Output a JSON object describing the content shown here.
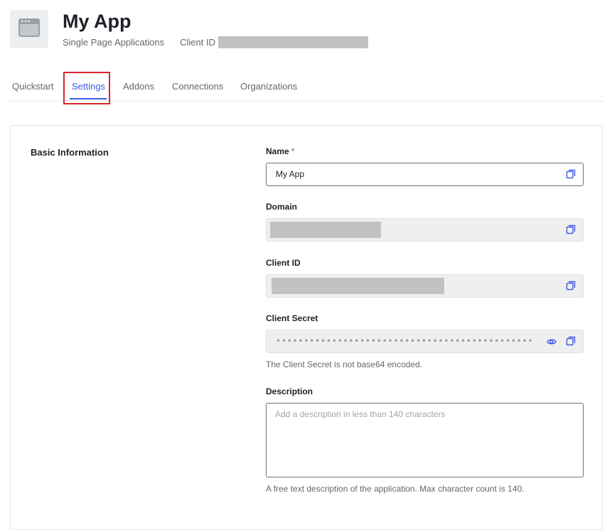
{
  "app": {
    "title": "My App",
    "type": "Single Page Applications",
    "client_id_label": "Client ID"
  },
  "tabs": [
    {
      "label": "Quickstart"
    },
    {
      "label": "Settings",
      "active": true
    },
    {
      "label": "Addons"
    },
    {
      "label": "Connections"
    },
    {
      "label": "Organizations"
    }
  ],
  "section": {
    "title": "Basic Information"
  },
  "fields": {
    "name": {
      "label": "Name",
      "required_mark": "*",
      "value": "My App"
    },
    "domain": {
      "label": "Domain"
    },
    "client_id": {
      "label": "Client ID"
    },
    "client_secret": {
      "label": "Client Secret",
      "mask": "••••••••••••••••••••••••••••••••••••••••••••••••••",
      "helper": "The Client Secret is not base64 encoded."
    },
    "description": {
      "label": "Description",
      "placeholder": "Add a description in less than 140 characters",
      "helper": "A free text description of the application. Max character count is 140."
    }
  },
  "colors": {
    "accent": "#3f59e4",
    "highlight_border": "#d9242c",
    "redaction": "#c2c2c2"
  },
  "icons": [
    "app-icon",
    "copy-icon",
    "eye-icon"
  ]
}
